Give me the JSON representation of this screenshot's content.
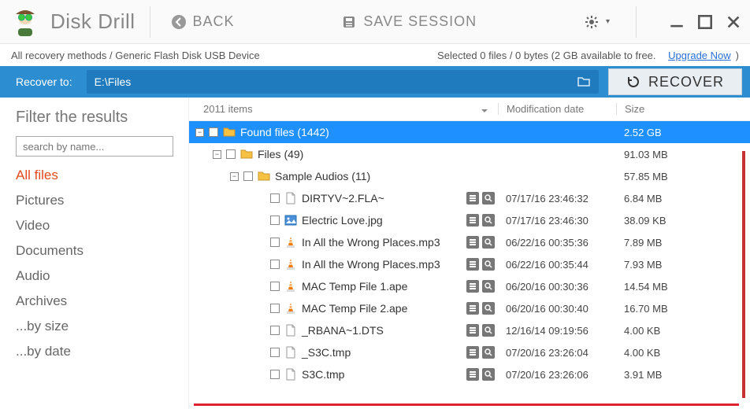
{
  "app": {
    "title": "Disk Drill"
  },
  "toolbar": {
    "back_label": "BACK",
    "save_session_label": "SAVE SESSION"
  },
  "breadcrumb": {
    "methods": "All recovery methods",
    "device": "Generic Flash Disk USB Device"
  },
  "status": {
    "selected": "Selected 0 files / 0 bytes (2 GB available to free.",
    "upgrade": "Upgrade Now",
    "trail": ")"
  },
  "recover_bar": {
    "label": "Recover to:",
    "path": "E:\\Files",
    "button": "RECOVER"
  },
  "sidebar": {
    "title": "Filter the results",
    "search_placeholder": "search by name...",
    "items": [
      "All files",
      "Pictures",
      "Video",
      "Documents",
      "Audio",
      "Archives",
      "...by size",
      "...by date"
    ],
    "active_index": 0
  },
  "columns": {
    "name": "2011 items",
    "mod": "Modification date",
    "size": "Size"
  },
  "tree": [
    {
      "indent": 0,
      "expander": "-",
      "icon": "folder",
      "label": "Found files (1442)",
      "mod": "",
      "size": "2.52 GB",
      "selected": true,
      "actions": false
    },
    {
      "indent": 1,
      "expander": "-",
      "icon": "folder",
      "label": "Files (49)",
      "mod": "",
      "size": "91.03 MB",
      "selected": false,
      "actions": false
    },
    {
      "indent": 2,
      "expander": "-",
      "icon": "folder",
      "label": "Sample Audios (11)",
      "mod": "",
      "size": "57.85 MB",
      "selected": false,
      "actions": false
    },
    {
      "indent": 3,
      "expander": "",
      "icon": "file",
      "label": "DIRTYV~2.FLA~",
      "mod": "07/17/16 23:46:32",
      "size": "6.84 MB",
      "selected": false,
      "actions": true
    },
    {
      "indent": 3,
      "expander": "",
      "icon": "image",
      "label": "Electric Love.jpg",
      "mod": "07/17/16 23:46:30",
      "size": "38.09 KB",
      "selected": false,
      "actions": true
    },
    {
      "indent": 3,
      "expander": "",
      "icon": "vlc",
      "label": "In All the Wrong Places.mp3",
      "mod": "06/22/16 00:35:36",
      "size": "7.89 MB",
      "selected": false,
      "actions": true
    },
    {
      "indent": 3,
      "expander": "",
      "icon": "vlc",
      "label": "In All the Wrong Places.mp3",
      "mod": "06/22/16 00:35:44",
      "size": "7.93 MB",
      "selected": false,
      "actions": true
    },
    {
      "indent": 3,
      "expander": "",
      "icon": "vlc",
      "label": "MAC Temp File 1.ape",
      "mod": "06/20/16 00:30:36",
      "size": "14.54 MB",
      "selected": false,
      "actions": true
    },
    {
      "indent": 3,
      "expander": "",
      "icon": "vlc",
      "label": "MAC Temp File 2.ape",
      "mod": "06/20/16 00:30:40",
      "size": "16.70 MB",
      "selected": false,
      "actions": true
    },
    {
      "indent": 3,
      "expander": "",
      "icon": "file",
      "label": "_RBANA~1.DTS",
      "mod": "12/16/14 09:19:56",
      "size": "4.00 KB",
      "selected": false,
      "actions": true
    },
    {
      "indent": 3,
      "expander": "",
      "icon": "file",
      "label": "_S3C.tmp",
      "mod": "07/20/16 23:26:04",
      "size": "4.00 KB",
      "selected": false,
      "actions": true
    },
    {
      "indent": 3,
      "expander": "",
      "icon": "file",
      "label": "S3C.tmp",
      "mod": "07/20/16 23:26:06",
      "size": "3.91 MB",
      "selected": false,
      "actions": true
    }
  ]
}
